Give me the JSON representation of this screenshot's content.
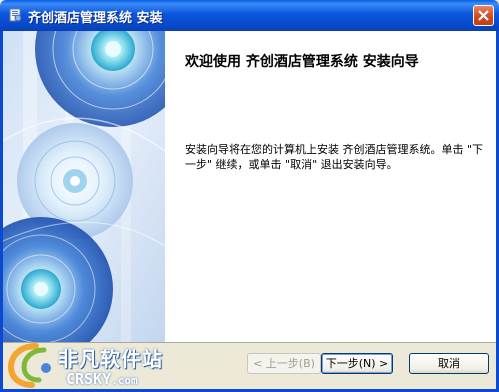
{
  "window": {
    "title": "齐创酒店管理系统 安装",
    "icon": "installer-icon",
    "close_icon": "close-icon"
  },
  "wizard": {
    "heading": "欢迎使用 齐创酒店管理系统 安装向导",
    "description": "安装向导将在您的计算机上安装 齐创酒店管理系统。单击 \"下一步\" 继续，或单击 \"取消\" 退出安装向导。"
  },
  "buttons": {
    "back": "< 上一步(B)",
    "next": "下一步(N) >",
    "cancel": "取消"
  },
  "watermark": {
    "title": "非凡软件站",
    "domain": "CRSKY",
    "domain_suffix": ".com"
  },
  "colors": {
    "titlebar": "#0b56de",
    "frame": "#0a49d0",
    "face": "#ece9d8",
    "close_button": "#d24a1f"
  }
}
